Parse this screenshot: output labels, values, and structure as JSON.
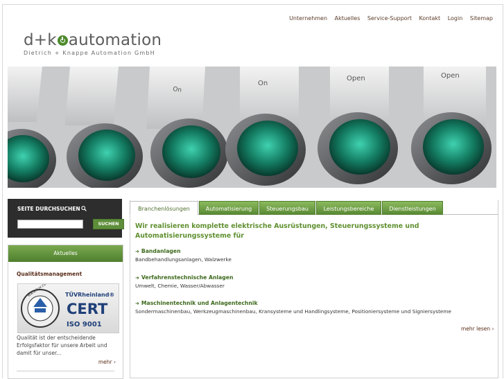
{
  "topnav": [
    "Unternehmen",
    "Aktuelles",
    "Service-Support",
    "Kontakt",
    "Login",
    "Sitemap"
  ],
  "logo": {
    "pre": "d+k",
    "post": "automation",
    "subtitle": "Dietrich + Knappe Automation GmbH"
  },
  "hero": {
    "labels": [
      "On",
      "On",
      "Open",
      "Open"
    ]
  },
  "search": {
    "title": "SEITE DURCHSUCHEN",
    "button": "SUCHEN",
    "value": ""
  },
  "aktuelles": {
    "title": "Aktuelles",
    "item_title": "Qualitätsmanagement",
    "cert": {
      "ring_text": "www.tuv.com",
      "brand": "TÜVRheinland®",
      "big": "CERT",
      "norm": "ISO 9001"
    },
    "text": "Qualität ist der entscheidende Erfolgsfaktor für unsere Arbeit und damit für unser...",
    "more": "mehr ›"
  },
  "tabs": [
    "Branchenlösungen",
    "Automatisierung",
    "Steuerungsbau",
    "Leistungsbereiche",
    "Dienstleistungen"
  ],
  "main": {
    "headline": "Wir realisieren komplette elektrische Ausrüstungen, Steuerungssysteme und Automatisierungssysteme für",
    "entries": [
      {
        "title": "Bandanlagen",
        "desc": "Bandbehandlungsanlagen, Walzwerke"
      },
      {
        "title": "Verfahrenstechnische Anlagen",
        "desc": "Umwelt, Chemie, Wasser/Abwasser"
      },
      {
        "title": "Maschinentechnik und Anlagentechnik",
        "desc": "Sondermaschinenbau, Werkzeugmaschinenbau, Kransysteme und Handlingsysteme, Positioniersysteme und Signiersysteme"
      }
    ],
    "more": "mehr lesen ›"
  },
  "colors": {
    "accent": "#5f8f2f",
    "dark": "#2d2d2d",
    "link_brown": "#5a2e1a"
  }
}
